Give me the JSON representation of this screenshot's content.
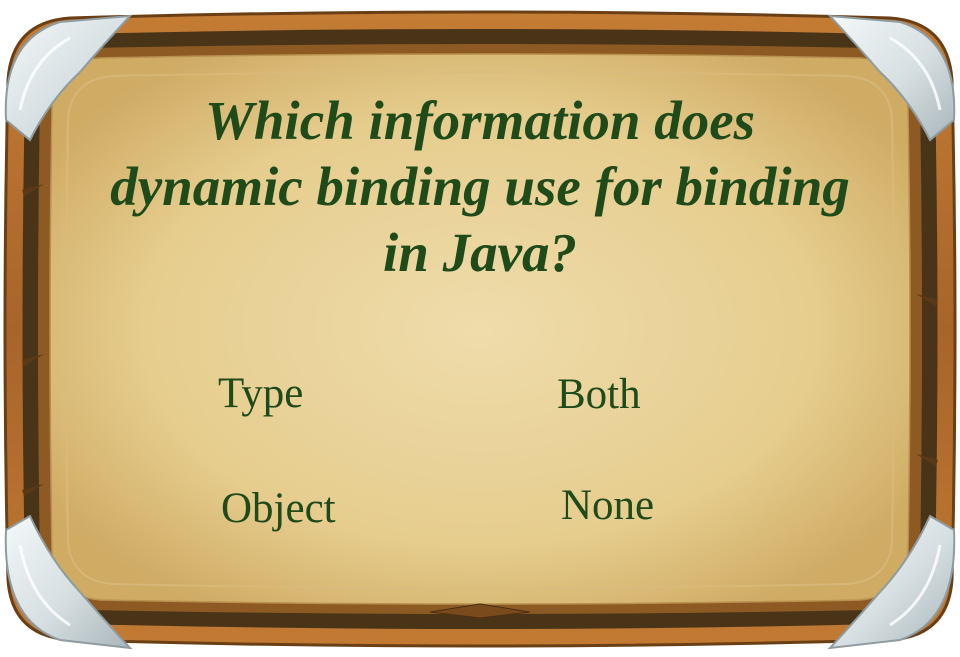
{
  "question": "Which information does dynamic binding use for binding in Java?",
  "options": [
    {
      "label": "Type"
    },
    {
      "label": "Both"
    },
    {
      "label": "Object"
    },
    {
      "label": "None"
    }
  ],
  "colors": {
    "text": "#1f4a1a",
    "parchment_center": "#ecd7a4",
    "parchment_edge": "#d3b06a",
    "frame_outer": "#b8712c",
    "frame_dark": "#4a3418",
    "corner_metal": "#dfe6e8"
  },
  "icons": [
    "corner-clip-icon",
    "bottom-ornament-icon"
  ]
}
